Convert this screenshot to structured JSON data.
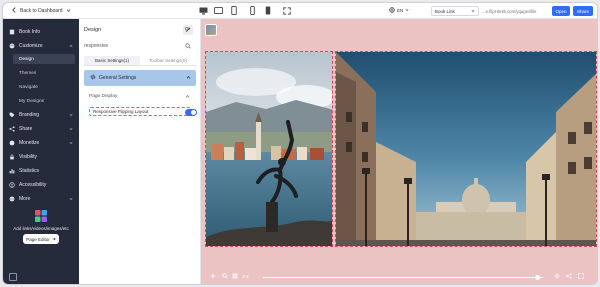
{
  "topbar": {
    "back_label": "Back to Dashboard",
    "language": "EN",
    "link_type": "Book Link",
    "url_text": "...e.flipHtml5.com/yqagwi/file",
    "open_label": "Open",
    "share_label": "Share"
  },
  "nav": {
    "book_info": "Book Info",
    "customize": "Customize",
    "sub_items": [
      "Design",
      "Themes",
      "Navigate",
      "My Designs"
    ],
    "branding": "Branding",
    "share": "Share",
    "monetize": "Monetize",
    "visibility": "Visibility",
    "statistics": "Statistics",
    "accessibility": "Accessibility",
    "more": "More",
    "promo_text": "Add links/videos/images/etc",
    "page_editor_label": "Page Editor"
  },
  "panel": {
    "title": "Design",
    "search_value": "responsive",
    "tabs": [
      "Basic Settings(1)",
      "Toolbar Settings(0)"
    ],
    "section_title": "General Settings",
    "subsection_title": "Page Display",
    "option_label": "Responsive Flipping Layout",
    "option_enabled": true
  },
  "player": {
    "page_indicator": "2-3",
    "progress": 0.98
  },
  "colors": {
    "accent": "#2f6df6",
    "nav_bg": "#262b3b",
    "canvas_bg": "#ebc3c3",
    "section_bg": "#a7c7ea",
    "outline": "#d7455a"
  }
}
